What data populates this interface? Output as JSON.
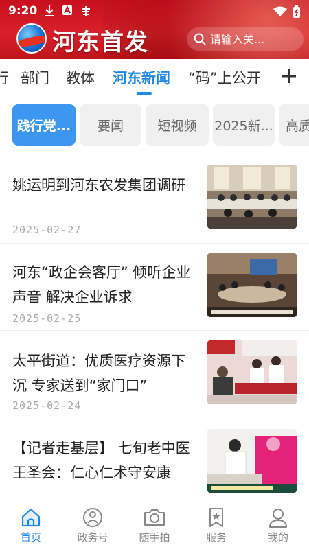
{
  "status_bar": {
    "time": "9:20"
  },
  "header": {
    "brand": "河东首发",
    "search_placeholder": "请输入关..."
  },
  "channels": [
    "行",
    "部门",
    "教体",
    "河东新闻",
    "“码”上公开"
  ],
  "active_channel": "河东新闻",
  "subtabs": [
    "践行党...",
    "要闻",
    "短视频",
    "2025新...",
    "高质"
  ],
  "active_subtab": "践行党...",
  "news": [
    {
      "title": "姚运明到河东农发集团调研",
      "date": "2025-02-27",
      "thumb": "meeting-room-photo"
    },
    {
      "title": "河东“政企会客厅” 倾听企业声音 解决企业诉求",
      "date": "2025-02-25",
      "thumb": "conference-photo"
    },
    {
      "title": "太平街道：优质医疗资源下沉 专家送到“家门口”",
      "date": "2025-02-24",
      "thumb": "medical-service-photo"
    },
    {
      "title": "【记者走基层】 七旬老中医王圣会：仁心仁术守安康",
      "date": "",
      "thumb": "clinic-photo"
    }
  ],
  "bottom_nav": [
    {
      "label": "首页",
      "icon": "home-icon",
      "active": true
    },
    {
      "label": "政务号",
      "icon": "gov-account-icon",
      "active": false
    },
    {
      "label": "随手拍",
      "icon": "camera-icon",
      "active": false
    },
    {
      "label": "服务",
      "icon": "service-bookmark-icon",
      "active": false
    },
    {
      "label": "我的",
      "icon": "profile-icon",
      "active": false
    }
  ],
  "colors": {
    "header_red": "#d8202a",
    "accent_blue": "#1e88e5",
    "chip_blue": "#3d96f0"
  }
}
